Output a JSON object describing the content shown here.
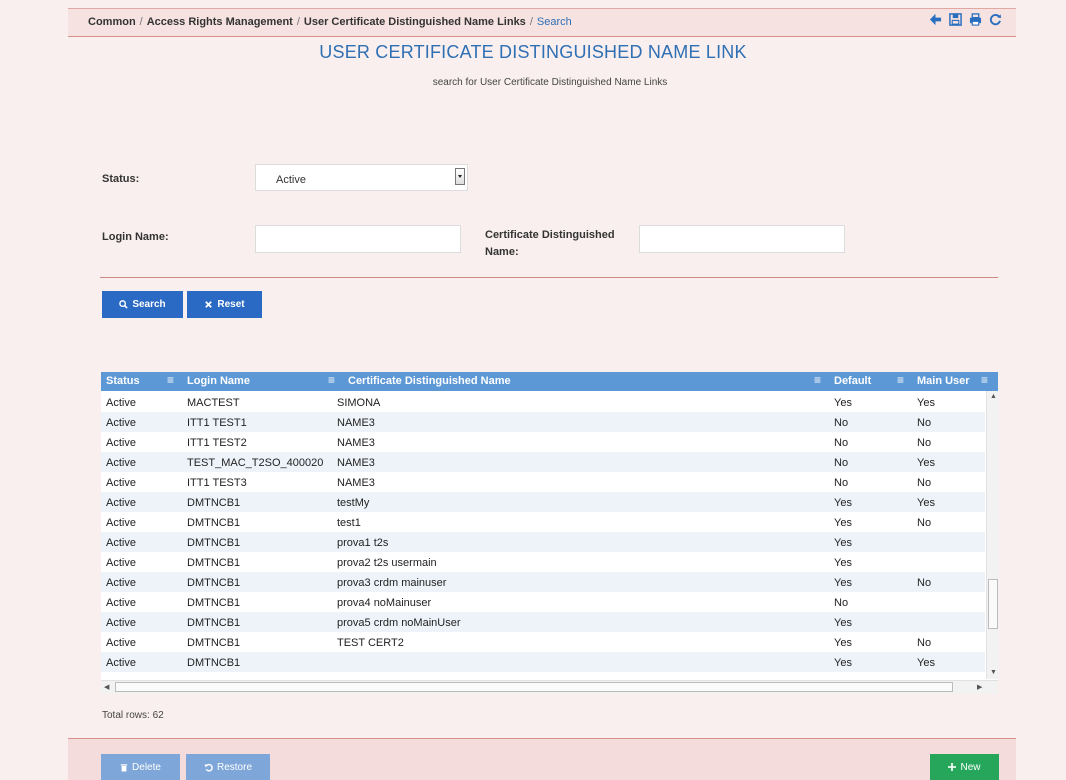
{
  "breadcrumb": {
    "items": [
      "Common",
      "Access Rights Management",
      "User Certificate Distinguished Name Links"
    ],
    "current": "Search"
  },
  "toolbar_icons": [
    "back-arrow-icon",
    "save-icon",
    "print-icon",
    "refresh-icon"
  ],
  "page": {
    "title": "USER CERTIFICATE DISTINGUISHED NAME LINK",
    "subtitle": "search for User Certificate Distinguished Name Links"
  },
  "form": {
    "status_label": "Status:",
    "status_value": "Active",
    "login_label": "Login Name:",
    "login_value": "",
    "cert_label_line1": "Certificate Distinguished",
    "cert_label_line2": "Name:",
    "cert_value": ""
  },
  "buttons": {
    "search": "Search",
    "reset": "Reset",
    "delete": "Delete",
    "restore": "Restore",
    "new": "New"
  },
  "table": {
    "columns": [
      "Status",
      "Login Name",
      "Certificate Distinguished Name",
      "Default",
      "Main User"
    ],
    "rows": [
      [
        "Active",
        "MACTEST",
        "SIMONA",
        "Yes",
        "Yes"
      ],
      [
        "Active",
        "ITT1 TEST1",
        "NAME3",
        "No",
        "No"
      ],
      [
        "Active",
        "ITT1 TEST2",
        "NAME3",
        "No",
        "No"
      ],
      [
        "Active",
        "TEST_MAC_T2SO_400020",
        "NAME3",
        "No",
        "Yes"
      ],
      [
        "Active",
        "ITT1 TEST3",
        "NAME3",
        "No",
        "No"
      ],
      [
        "Active",
        "DMTNCB1",
        "testMy",
        "Yes",
        "Yes"
      ],
      [
        "Active",
        "DMTNCB1",
        "test1",
        "Yes",
        "No"
      ],
      [
        "Active",
        "DMTNCB1",
        "prova1 t2s",
        "Yes",
        ""
      ],
      [
        "Active",
        "DMTNCB1",
        "prova2 t2s usermain",
        "Yes",
        ""
      ],
      [
        "Active",
        "DMTNCB1",
        "prova3 crdm mainuser",
        "Yes",
        "No"
      ],
      [
        "Active",
        "DMTNCB1",
        "prova4 noMainuser",
        "No",
        ""
      ],
      [
        "Active",
        "DMTNCB1",
        "prova5 crdm noMainUser",
        "Yes",
        ""
      ],
      [
        "Active",
        "DMTNCB1",
        "TEST CERT2",
        "Yes",
        "No"
      ],
      [
        "Active",
        "DMTNCB1",
        "",
        "Yes",
        "Yes"
      ]
    ],
    "total_rows": "Total rows: 62"
  },
  "colors": {
    "accent": "#2a6ac4",
    "header": "#5c97d6",
    "new_button": "#26a65b",
    "disabled_button": "#7ea6d8"
  }
}
